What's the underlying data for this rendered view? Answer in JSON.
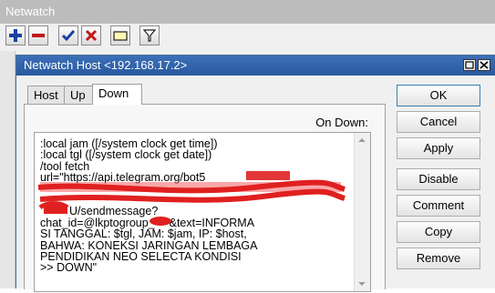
{
  "outer_window": {
    "title": "Netwatch",
    "toolbar": [
      "add-icon",
      "remove-icon",
      "enable-check-icon",
      "disable-x-icon",
      "comment-icon",
      "filter-icon"
    ]
  },
  "dialog": {
    "title": "Netwatch Host <192.168.17.2>",
    "tabs": [
      {
        "label": "Host",
        "active": false
      },
      {
        "label": "Up",
        "active": false
      },
      {
        "label": "Down",
        "active": true
      }
    ],
    "field_label": "On Down:",
    "script_lines": [
      ":local jam ([/system clock get time])",
      ":local tgl ([/system clock get date])",
      "/tool fetch",
      "url=\"https://api.telegram.org/bot5",
      "",
      "",
      "U/sendmessage?",
      "chat_id=@lkptogroup_",
      "SI TANGGAL: $tgl, JAM: $jam, IP: $host,",
      "BAHWA: KONEKSI JARINGAN LEMBAGA",
      "PENDIDIKAN NEO SELECTA KONDISI",
      ">> DOWN\""
    ],
    "script_text_line7_tail": "&text=INFORMA",
    "buttons": [
      "OK",
      "Cancel",
      "Apply",
      "Disable",
      "Comment",
      "Copy",
      "Remove"
    ]
  },
  "colors": {
    "title_bar": "#2a5aa0",
    "redaction": "#e02020"
  }
}
